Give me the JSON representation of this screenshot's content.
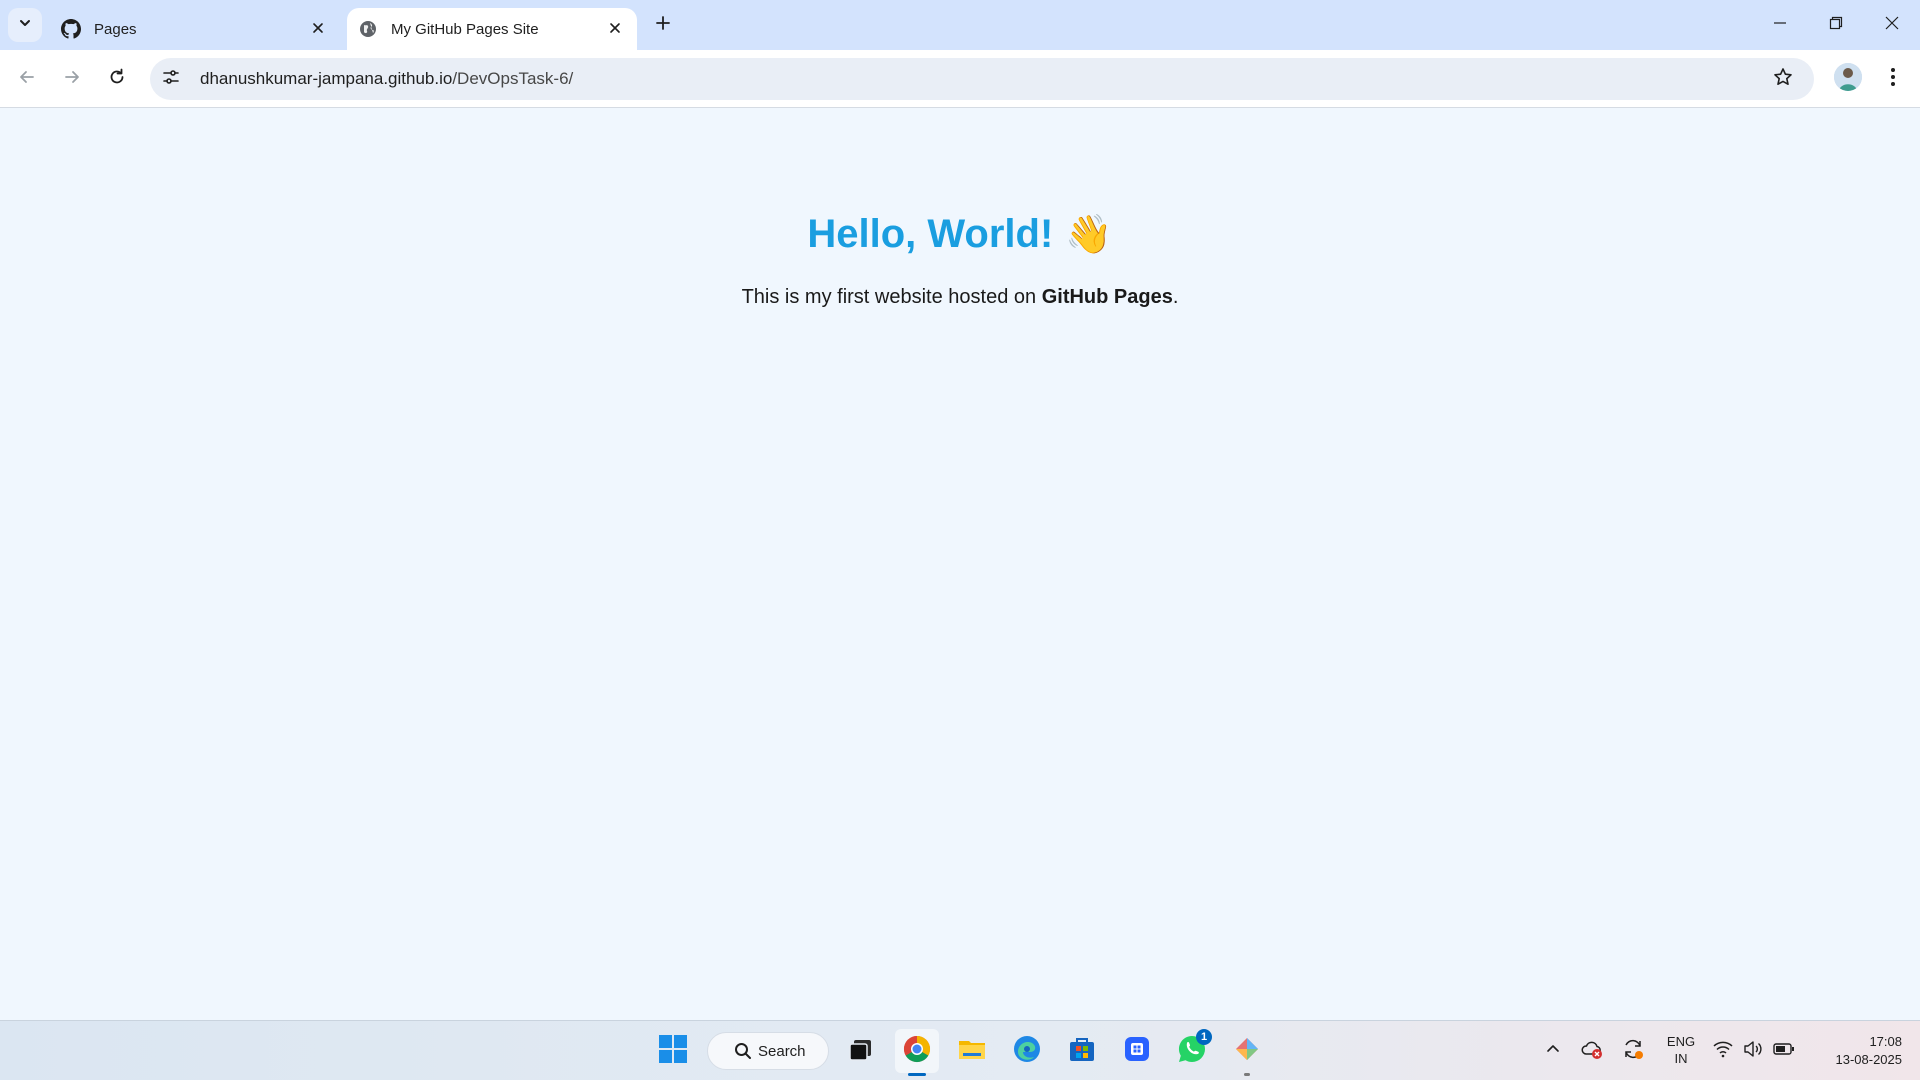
{
  "browser": {
    "tabs": [
      {
        "title": "Pages",
        "favicon": "github-icon",
        "active": false
      },
      {
        "title": "My GitHub Pages Site",
        "favicon": "globe-icon",
        "active": true
      }
    ],
    "url_host": "dhanushkumar-jampana.github.io",
    "url_path": "/DevOpsTask-6/"
  },
  "page": {
    "heading": "Hello, World!",
    "heading_emoji": "👋",
    "text_before": "This is my first website hosted on ",
    "text_bold": "GitHub Pages",
    "text_after": ".",
    "heading_color": "#1a9ee0",
    "background": "#f0f7fe"
  },
  "taskbar": {
    "search_label": "Search",
    "whatsapp_badge": "1",
    "language_primary": "ENG",
    "language_secondary": "IN",
    "time": "17:08",
    "date": "13-08-2025"
  }
}
